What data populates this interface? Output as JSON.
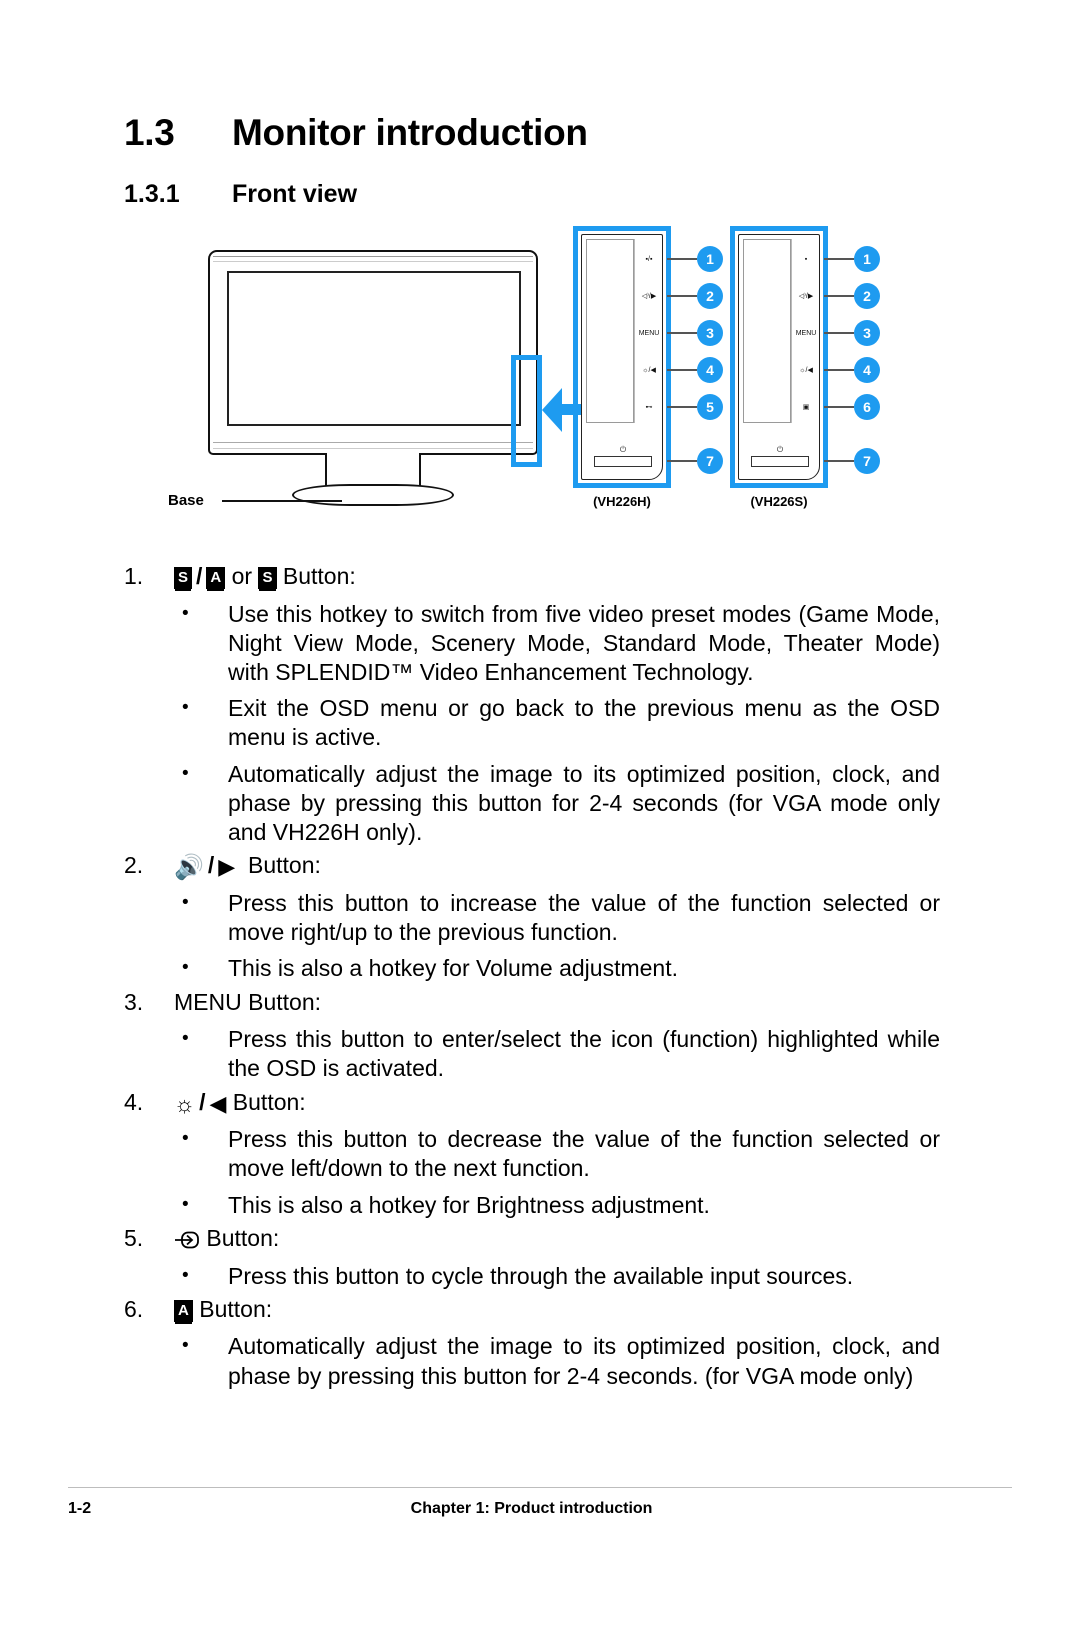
{
  "heading": {
    "section_number": "1.3",
    "section_title": "Monitor introduction",
    "sub_number": "1.3.1",
    "sub_title": "Front view"
  },
  "figure": {
    "base_label": "Base",
    "panels": [
      {
        "model_label": "(VH226H)",
        "buttons": [
          {
            "glyph": "▪/▪",
            "name": "splendid-auto-button",
            "callout": "1"
          },
          {
            "glyph": "◁⁾/▶",
            "name": "volume-right-button",
            "callout": "2"
          },
          {
            "glyph": "MENU",
            "name": "menu-button",
            "callout": "3"
          },
          {
            "glyph": "☼/◀",
            "name": "brightness-left-button",
            "callout": "4"
          },
          {
            "glyph": "⊷",
            "name": "input-source-button",
            "callout": "5"
          }
        ],
        "power": {
          "glyph": "⏻",
          "name": "power-button",
          "callout": "7"
        }
      },
      {
        "model_label": "(VH226S)",
        "buttons": [
          {
            "glyph": "▪",
            "name": "splendid-button",
            "callout": "1"
          },
          {
            "glyph": "◁⁾/▶",
            "name": "volume-right-button",
            "callout": "2"
          },
          {
            "glyph": "MENU",
            "name": "menu-button",
            "callout": "3"
          },
          {
            "glyph": "☼/◀",
            "name": "brightness-left-button",
            "callout": "4"
          },
          {
            "glyph": "▣",
            "name": "auto-adjust-button",
            "callout": "6"
          }
        ],
        "power": {
          "glyph": "⏻",
          "name": "power-button",
          "callout": "7"
        }
      }
    ]
  },
  "items": [
    {
      "index": "1.",
      "title_suffix": "Button:",
      "glyph_s": "S",
      "glyph_a": "A",
      "or_word": "or",
      "bullets": [
        "Use this hotkey to switch from five video preset modes (Game Mode, Night View Mode, Scenery Mode, Standard Mode, Theater Mode) with SPLENDID™ Video Enhancement Technology.",
        "Exit the OSD menu or go back to the previous menu as the OSD menu is active.",
        "Automatically adjust the image to its optimized position, clock, and phase by pressing this button for 2-4 seconds (for VGA mode only and VH226H only)."
      ]
    },
    {
      "index": "2.",
      "title_suffix": "Button:",
      "bullets": [
        "Press this button to increase the value of the function selected or move right/up to the previous function.",
        "This is also a hotkey for Volume adjustment."
      ]
    },
    {
      "index": "3.",
      "title": "MENU Button:",
      "bullets": [
        "Press this button to enter/select the icon (function) highlighted while the OSD is activated."
      ]
    },
    {
      "index": "4.",
      "title_suffix": "Button:",
      "bullets": [
        "Press this button to decrease the value of the function selected or move left/down to the next function.",
        "This is also a hotkey for Brightness adjustment."
      ]
    },
    {
      "index": "5.",
      "title_suffix": "Button:",
      "bullets": [
        "Press this button to cycle through the available input sources."
      ]
    },
    {
      "index": "6.",
      "title_suffix": "Button:",
      "glyph_a": "A",
      "bullets": [
        "Automatically adjust the image to its optimized position, clock, and phase by pressing this button for 2-4 seconds.  (for VGA mode only)"
      ]
    }
  ],
  "footer": {
    "page_number": "1-2",
    "chapter": "Chapter 1: Product introduction"
  },
  "colors": {
    "accent_blue": "#1e9bf0",
    "text": "#000000",
    "rule": "#bdbdbd"
  }
}
